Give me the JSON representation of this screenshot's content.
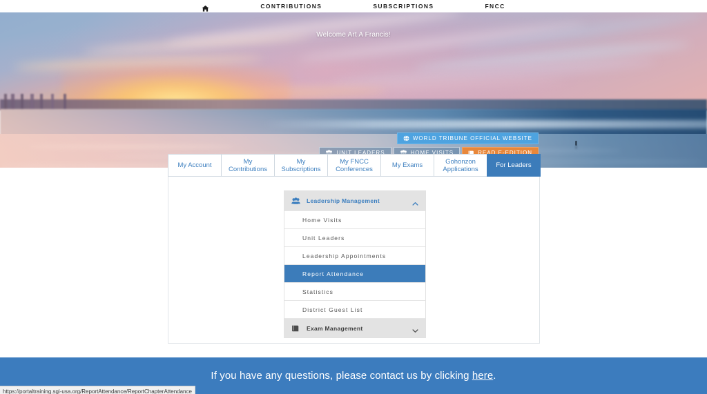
{
  "topnav": {
    "home_icon": "home-icon",
    "items": [
      {
        "label": "CONTRIBUTIONS"
      },
      {
        "label": "SUBSCRIPTIONS"
      },
      {
        "label": "FNCC"
      }
    ]
  },
  "hero": {
    "welcome": "Welcome Art A Francis!",
    "buttons": [
      {
        "label": "WORLD TRIBUNE OFFICIAL WEBSITE",
        "icon": "globe-icon",
        "style": "blue"
      },
      {
        "label": "UNIT LEADERS",
        "icon": "people-icon",
        "style": "ghost"
      },
      {
        "label": "HOME VISITS",
        "icon": "people-icon",
        "style": "ghost"
      },
      {
        "label": "READ E-EDITION",
        "icon": "book-icon",
        "style": "orange"
      }
    ]
  },
  "tabs": [
    {
      "label": "My Account",
      "active": false
    },
    {
      "label": "My Contributions",
      "active": false
    },
    {
      "label": "My Subscriptions",
      "active": false
    },
    {
      "label": "My FNCC Conferences",
      "active": false
    },
    {
      "label": "My Exams",
      "active": false
    },
    {
      "label": "Gohonzon Applications",
      "active": false
    },
    {
      "label": "For Leaders",
      "active": true
    }
  ],
  "accordion": {
    "leadership": {
      "title": "Leadership Management",
      "icon": "people-icon",
      "chevron": "chevron-up-icon",
      "expanded": true,
      "items": [
        {
          "label": "Home Visits",
          "selected": false
        },
        {
          "label": "Unit Leaders",
          "selected": false
        },
        {
          "label": "Leadership Appointments",
          "selected": false
        },
        {
          "label": "Report Attendance",
          "selected": true
        },
        {
          "label": "Statistics",
          "selected": false
        },
        {
          "label": "District Guest List",
          "selected": false
        }
      ]
    },
    "exam": {
      "title": "Exam Management",
      "icon": "book-icon",
      "chevron": "chevron-down-icon",
      "expanded": false
    }
  },
  "footer": {
    "text_before": "If you have any questions, please contact us by clicking ",
    "link": "here",
    "text_after": "."
  },
  "statusbar": {
    "url": "https://portaltraining.sgi-usa.org/ReportAttendance/ReportChapterAttendance"
  },
  "colors": {
    "accent_blue": "#3c7cba",
    "link_blue": "#3d7fbf",
    "footer_blue": "#3c7cbe",
    "button_blue": "#4ea3e0",
    "button_orange": "#e8873a",
    "panel_gray": "#e3e3e3"
  }
}
